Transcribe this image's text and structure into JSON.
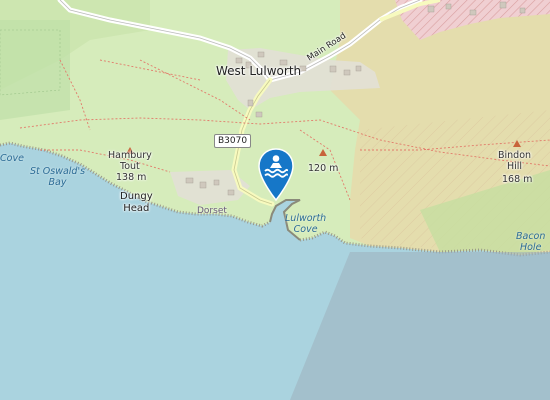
{
  "labels": {
    "town": "West Lulworth",
    "road_main": "Main Road",
    "road_shield": "B3070",
    "hambury_name": "Hambury\nTout",
    "hambury_elev": "138 m",
    "dungy": "Dungy\nHead",
    "st_oswalds": "St Oswald's\nBay",
    "lulworth_cove": "Lulworth\nCove",
    "elev_120": "120 m",
    "bindon_name": "Bindon\nHill",
    "bindon_elev": "168 m",
    "bacon_hole": "Bacon\nHole",
    "cove_left": "Cove",
    "dorset": "Dorset"
  },
  "icons": {
    "marker": "swimming-marker-icon",
    "peak": "peak-triangle-icon"
  },
  "colors": {
    "sea": "#aad3df",
    "grass": "#cdebb0",
    "military": "#f2dfbe",
    "residential": "#e5cfcf",
    "marker": "#1677c8"
  }
}
